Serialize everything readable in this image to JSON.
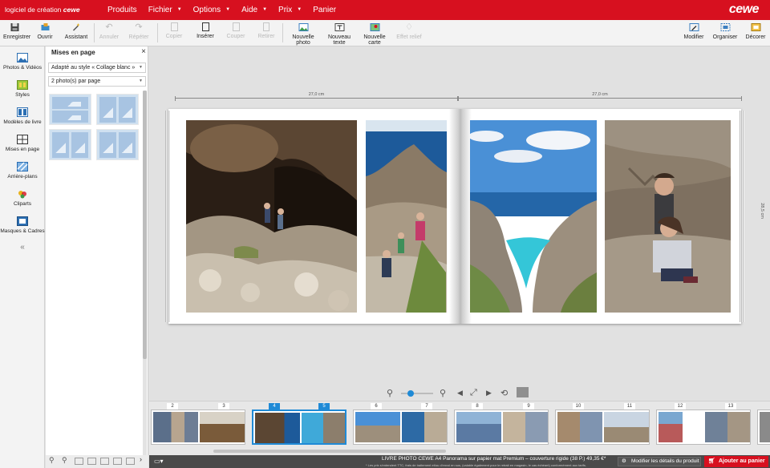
{
  "app": {
    "title_prefix": "logiciel de création",
    "title_brand": "cewe",
    "brand": "cewe"
  },
  "menu": [
    {
      "label": "Produits",
      "caret": false
    },
    {
      "label": "Fichier",
      "caret": true
    },
    {
      "label": "Options",
      "caret": true
    },
    {
      "label": "Aide",
      "caret": true
    },
    {
      "label": "Prix",
      "caret": true
    },
    {
      "label": "Panier",
      "caret": false
    }
  ],
  "toolbar": {
    "save": "Enregistrer",
    "open": "Ouvrir",
    "assistant": "Assistant",
    "undo": "Annuler",
    "redo": "Répéter",
    "copy": "Copier",
    "insert": "Insérer",
    "cut": "Couper",
    "delete": "Retirer",
    "new_photo": "Nouvelle photo",
    "new_text": "Nouveau texte",
    "new_map": "Nouvelle carte",
    "relief": "Effet relief",
    "edit": "Modifier",
    "organize": "Organiser",
    "decorate": "Décorer"
  },
  "rail": {
    "photos": "Photos & Vidéos",
    "styles": "Styles",
    "book_models": "Modèles de livre",
    "layouts": "Mises en page",
    "backgrounds": "Arrière-plans",
    "cliparts": "Cliparts",
    "masks": "Masques & Cadres",
    "collapse": "«"
  },
  "panel": {
    "title": "Mises en page",
    "close": "×",
    "style_select": "Adapté au style « Collage blanc »",
    "count_select": "2 photo(s) par page"
  },
  "canvas": {
    "ruler_left": "27,0 cm",
    "ruler_right": "27,0 cm",
    "ruler_vertical": "28,5 cm"
  },
  "filmstrip": {
    "pages": [
      "2",
      "3",
      "4",
      "5",
      "6",
      "7",
      "8",
      "9",
      "10",
      "11",
      "12",
      "13"
    ],
    "active_pages": [
      "4",
      "5"
    ]
  },
  "status": {
    "info": "LIVRE PHOTO CEWE A4 Panorama sur papier mat Premium – couverture rigide (38 P.) 49,35 €*",
    "note": "* Les prix s'entendent TTC, frais de traitement et/ou d'envoi en sus, (valable également pour le retrait en magasin, le cas échéant) conformément aux tarifs.",
    "details_button": "Modifier les détails du produit",
    "cart_button": "Ajouter au panier"
  },
  "colors": {
    "brand_red": "#d7101f",
    "accent_blue": "#1f8ad6"
  }
}
